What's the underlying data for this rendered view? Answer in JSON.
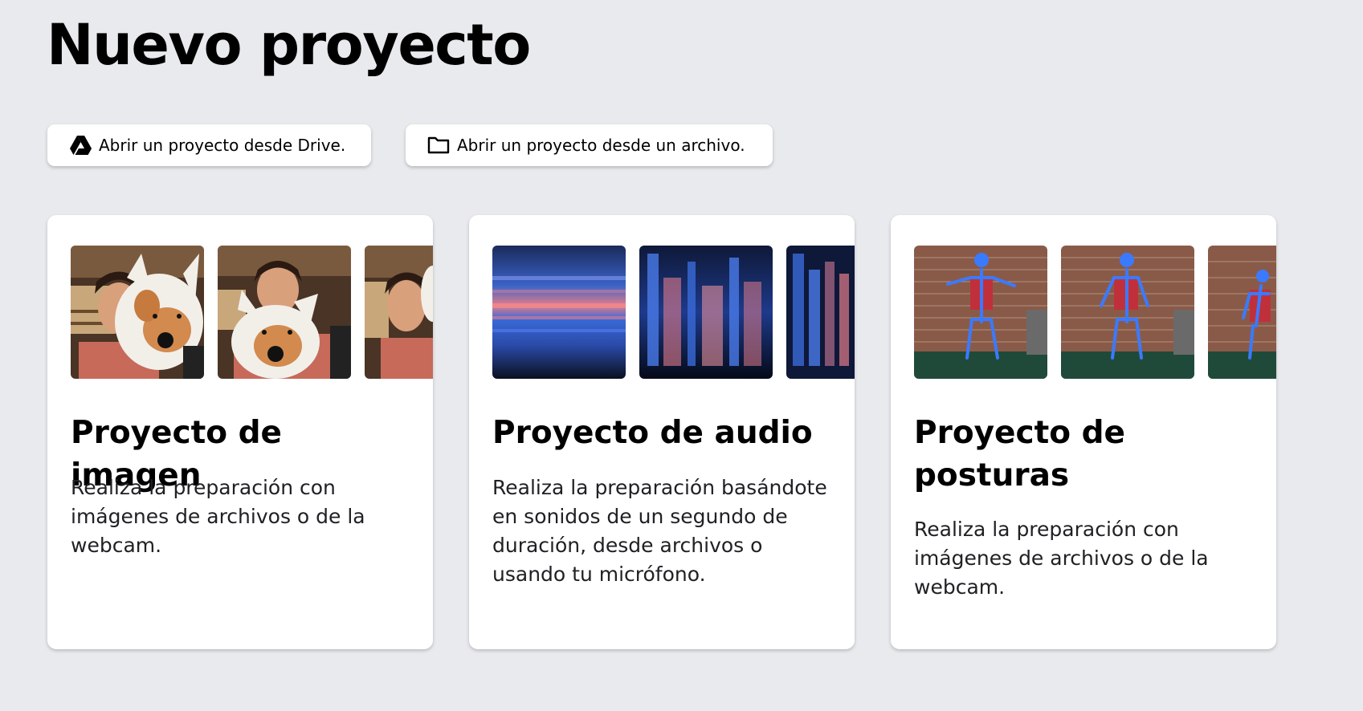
{
  "page": {
    "title": "Nuevo proyecto"
  },
  "actions": {
    "open_drive": {
      "label": "Abrir un proyecto desde Drive.",
      "icon": "google-drive-icon"
    },
    "open_file": {
      "label": "Abrir un proyecto desde un archivo.",
      "icon": "folder-icon"
    }
  },
  "projects": [
    {
      "title": "Proyecto de imagen",
      "description": "Realiza la preparación con imágenes de archivos o de la webcam."
    },
    {
      "title": "Proyecto de audio",
      "description": "Realiza la preparación basándote en sonidos de un segundo de duración, desde archivos o usando tu micrófono."
    },
    {
      "title": "Proyecto de posturas",
      "description": "Realiza la preparación con imágenes de archivos o de la webcam."
    }
  ]
}
